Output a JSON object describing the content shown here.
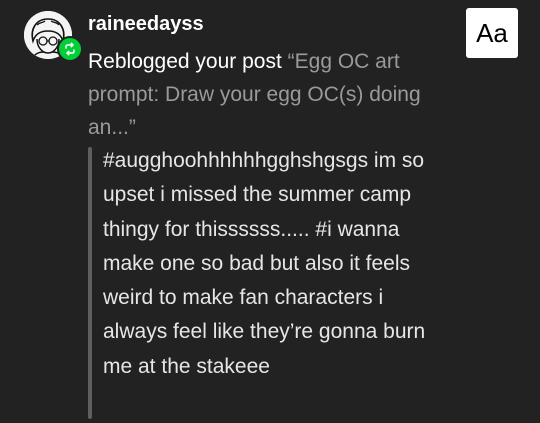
{
  "notification": {
    "username": "raineedayss",
    "action": "Reblogged your post",
    "post_excerpt": "“Egg OC art prompt: Draw your egg OC(s) doing an...”",
    "reblog_comment": "#augghoohhhhhhgghshgsgs im so upset i missed the summer camp thingy for thissssss..... #i wanna make one so bad but also it feels weird to make fan characters i always feel like they’re gonna burn me at the stakeee"
  },
  "toolbar": {
    "text_size_label": "Aa"
  },
  "colors": {
    "background": "#222222",
    "reblog_badge": "#00cf35",
    "muted_text": "#9a9a9a",
    "quote_bar": "#5f5f5f"
  },
  "icons": {
    "avatar": "avatar-drawing",
    "badge": "reblog-icon"
  }
}
